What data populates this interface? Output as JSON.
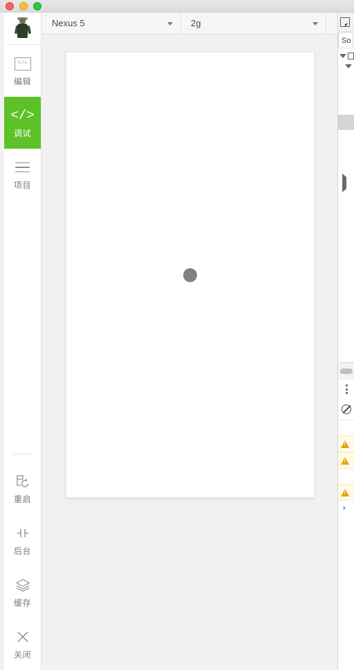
{
  "window": {
    "traffic_lights": [
      {
        "name": "close",
        "color": "#ff5f57"
      },
      {
        "name": "minimize",
        "color": "#febc2e"
      },
      {
        "name": "zoom",
        "color": "#28c840"
      }
    ]
  },
  "sidebar": {
    "avatar_label": "user-avatar",
    "top_items": [
      {
        "id": "edit",
        "label": "编辑",
        "icon": "code-box-icon",
        "active": false
      },
      {
        "id": "debug",
        "label": "调试",
        "icon": "code-icon",
        "active": true
      },
      {
        "id": "project",
        "label": "项目",
        "icon": "hamburger-icon",
        "active": false
      }
    ],
    "bottom_items": [
      {
        "id": "restart",
        "label": "重启",
        "icon": "restart-icon"
      },
      {
        "id": "background",
        "label": "后台",
        "icon": "background-icon"
      },
      {
        "id": "cache",
        "label": "缓存",
        "icon": "layers-icon"
      },
      {
        "id": "close",
        "label": "关闭",
        "icon": "close-x-icon"
      }
    ],
    "active_color": "#5cc227",
    "code_glyph": "</>"
  },
  "toolbar": {
    "device_select": {
      "value": "Nexus 5",
      "placeholder": "Nexus 5"
    },
    "network_select": {
      "value": "2g",
      "placeholder": "2g"
    }
  },
  "simulator": {
    "state": "loading",
    "spinner_color": "#808080"
  },
  "devtools": {
    "inspect_icon": "inspect-element-icon",
    "tab_label": "So",
    "tree_rows": [
      {
        "marker": "triangle-down",
        "text": ""
      },
      {
        "marker": "triangle-down-indent",
        "text": ""
      }
    ],
    "collapsed_marker": "triangle-right",
    "drawer_handle": "drawer-pill",
    "console_menu_icon": "kebab-menu-icon",
    "clear_console_icon": "clear-console-icon",
    "console_rows": [
      {
        "type": "blank"
      },
      {
        "type": "warning",
        "icon": "warning-icon"
      },
      {
        "type": "warning",
        "icon": "warning-icon"
      },
      {
        "type": "blank"
      },
      {
        "type": "warning",
        "icon": "warning-icon"
      }
    ],
    "prompt_glyph": "›",
    "prompt_color": "#3f7ad0"
  }
}
